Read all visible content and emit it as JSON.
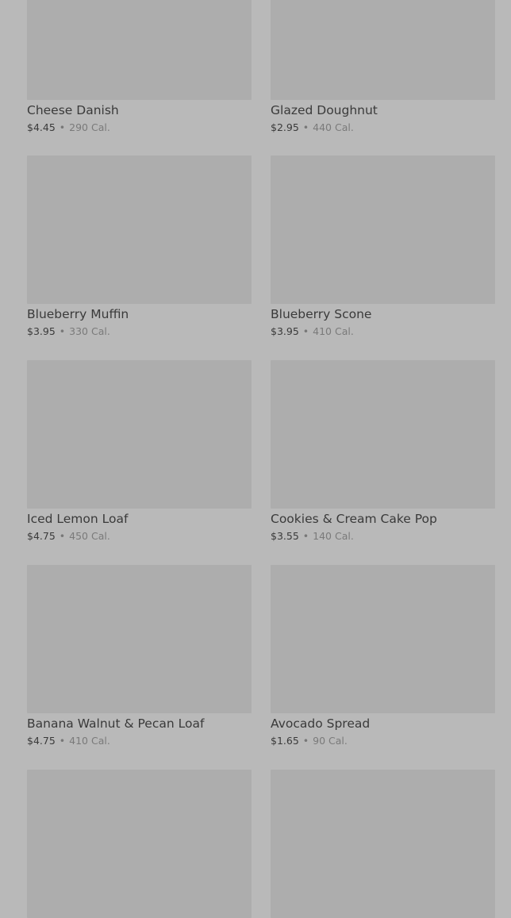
{
  "menu": {
    "items": [
      {
        "name": "Cheese Danish",
        "price": "$4.45",
        "calories": "290 Cal."
      },
      {
        "name": "Glazed Doughnut",
        "price": "$2.95",
        "calories": "440 Cal."
      },
      {
        "name": "Blueberry Muffin",
        "price": "$3.95",
        "calories": "330 Cal."
      },
      {
        "name": "Blueberry Scone",
        "price": "$3.95",
        "calories": "410 Cal."
      },
      {
        "name": "Iced Lemon Loaf",
        "price": "$4.75",
        "calories": "450 Cal."
      },
      {
        "name": "Cookies & Cream Cake Pop",
        "price": "$3.55",
        "calories": "140 Cal."
      },
      {
        "name": "Banana Walnut & Pecan Loaf",
        "price": "$4.75",
        "calories": "410 Cal."
      },
      {
        "name": "Avocado Spread",
        "price": "$1.65",
        "calories": "90 Cal."
      }
    ],
    "separator": "•"
  }
}
